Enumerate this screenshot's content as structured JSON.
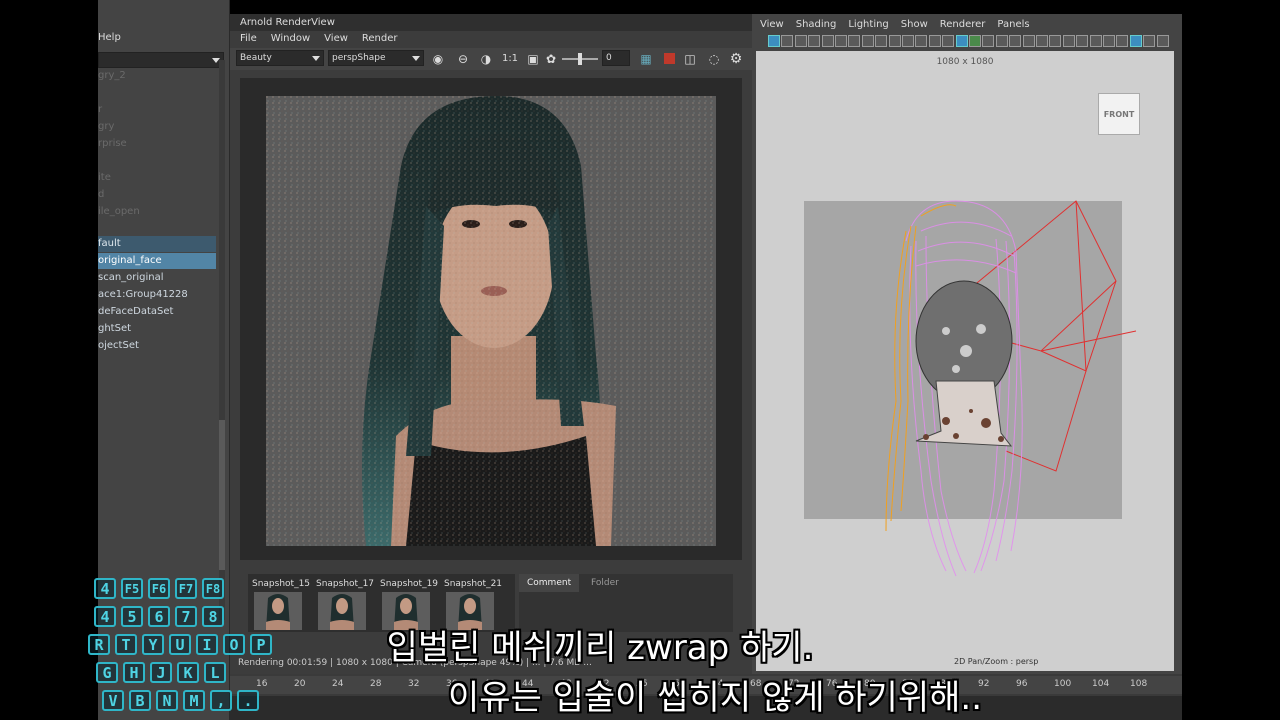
{
  "outliner": {
    "menu_help": "Help",
    "items": [
      {
        "label": "gry_2",
        "style": "faded"
      },
      {
        "label": "r",
        "style": "faded"
      },
      {
        "label": "gry",
        "style": "faded"
      },
      {
        "label": "rprise",
        "style": "faded"
      },
      {
        "label": "",
        "style": "faded"
      },
      {
        "label": "ite",
        "style": "faded"
      },
      {
        "label": "d",
        "style": "faded"
      },
      {
        "label": "ile_open",
        "style": "faded"
      },
      {
        "label": "fault",
        "style": "selbg"
      },
      {
        "label": "original_face",
        "style": "sel"
      },
      {
        "label": "scan_original",
        "style": "set"
      },
      {
        "label": "ace1:Group41228",
        "style": "set"
      },
      {
        "label": "deFaceDataSet",
        "style": "set"
      },
      {
        "label": "ghtSet",
        "style": "set"
      },
      {
        "label": "ojectSet",
        "style": "set"
      }
    ]
  },
  "keyboard": {
    "row1": [
      "4",
      "F5",
      "F6",
      "F7",
      "F8"
    ],
    "row2": [
      "4",
      "5",
      "6",
      "7",
      "8"
    ],
    "row3": [
      "R",
      "T",
      "Y",
      "U",
      "I",
      "O",
      "P"
    ],
    "row4": [
      "G",
      "H",
      "J",
      "K",
      "L"
    ],
    "row5": [
      "V",
      "B",
      "N",
      "M",
      ",",
      "."
    ]
  },
  "renderview": {
    "title": "Arnold RenderView",
    "menus": [
      "File",
      "Window",
      "View",
      "Render"
    ],
    "aov": "Beauty",
    "camera": "perspShape",
    "ratio": "1:1",
    "exposure": "0",
    "snapshots": [
      "Snapshot_15",
      "Snapshot_17",
      "Snapshot_19",
      "Snapshot_21"
    ],
    "tabs": {
      "comment": "Comment",
      "folder": "Folder"
    },
    "status": "Rendering 00:01:59 | 1080 x 1080 | Camera (perspShape 49%) | ... | 7.6 MB ..."
  },
  "viewport": {
    "menus": [
      "View",
      "Shading",
      "Lighting",
      "Show",
      "Renderer",
      "Panels"
    ],
    "resolution": "1080 x 1080",
    "cube_label": "FRONT",
    "hud": "2D Pan/Zoom : persp"
  },
  "timeline": {
    "ticks": [
      "16",
      "20",
      "24",
      "28",
      "32",
      "36",
      "40",
      "44",
      "48",
      "52",
      "56",
      "60",
      "64",
      "68",
      "72",
      "76",
      "80",
      "84",
      "88",
      "92",
      "96",
      "100",
      "104",
      "108"
    ]
  },
  "subtitles": {
    "line1": "입벌린 메쉬끼리 zwrap 하기.",
    "line2": "이유는 입술이 씹히지 않게 하기위해.."
  },
  "colors": {
    "selection": "#5285a6",
    "key_outline": "#2fb6c8",
    "hair_guides": "#e48cf0",
    "hair_curves_orange": "#f0a020",
    "camera_frustum": "#e03030"
  }
}
